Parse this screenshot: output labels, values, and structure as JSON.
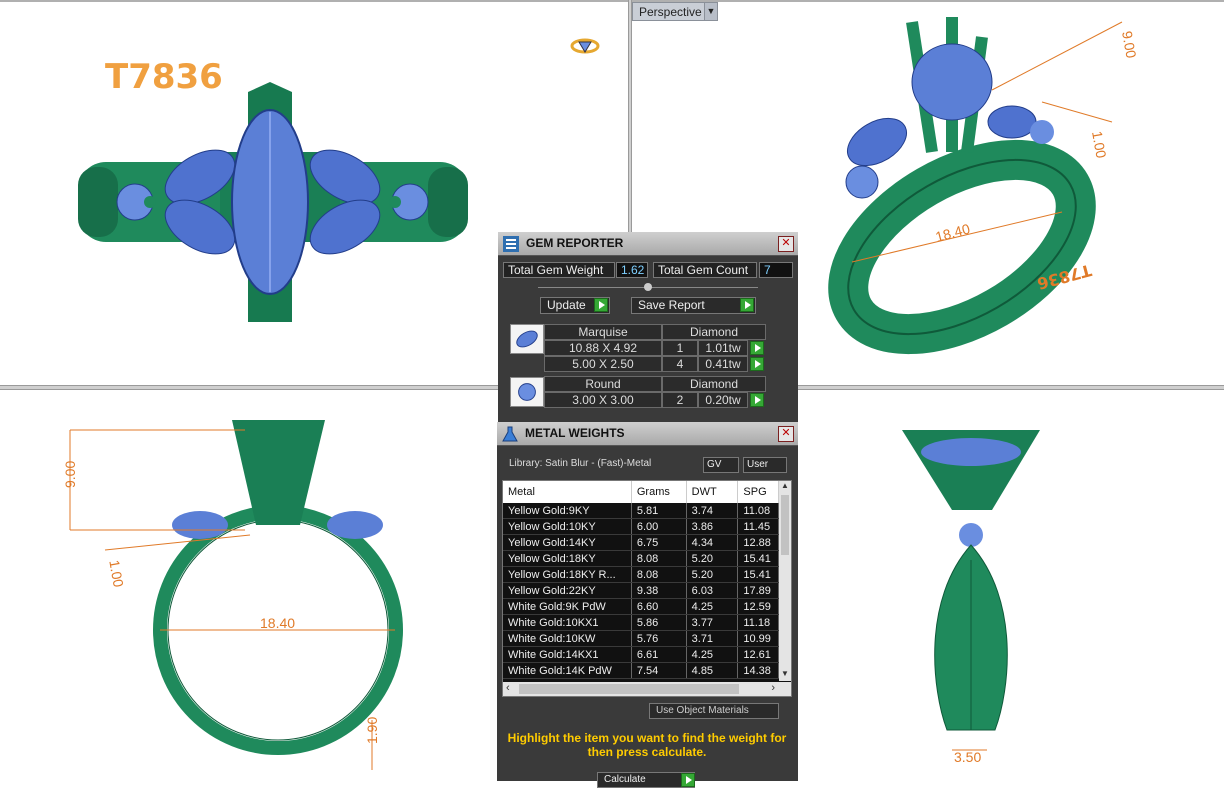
{
  "model_label": "T7836",
  "viewport_label": "Perspective",
  "dims": {
    "ring_width": "18.40",
    "height": "9.00",
    "band": "1.00",
    "shank": "1.90",
    "side_width": "3.50",
    "engraving": "T7836",
    "small_label": "1.00",
    "tiny_label": "1.90"
  },
  "gem_reporter": {
    "title": "GEM REPORTER",
    "total_weight_label": "Total Gem Weight",
    "total_weight": "1.62",
    "total_count_label": "Total Gem Count",
    "total_count": "7",
    "update_label": "Update",
    "save_label": "Save Report",
    "groups": [
      {
        "shape": "Marquise",
        "material": "Diamond",
        "rows": [
          {
            "size": "10.88 X 4.92",
            "count": "1",
            "weight": "1.01tw"
          },
          {
            "size": "5.00 X 2.50",
            "count": "4",
            "weight": "0.41tw"
          }
        ]
      },
      {
        "shape": "Round",
        "material": "Diamond",
        "rows": [
          {
            "size": "3.00 X 3.00",
            "count": "2",
            "weight": "0.20tw"
          }
        ]
      }
    ]
  },
  "metal_weights": {
    "title": "METAL WEIGHTS",
    "library": "Library: Satin Blur - (Fast)-Metal",
    "gv_label": "GV",
    "user_label": "User",
    "columns": [
      "Metal",
      "Grams",
      "DWT",
      "SPG"
    ],
    "rows": [
      [
        "Yellow Gold:9KY",
        "5.81",
        "3.74",
        "11.08"
      ],
      [
        "Yellow Gold:10KY",
        "6.00",
        "3.86",
        "11.45"
      ],
      [
        "Yellow Gold:14KY",
        "6.75",
        "4.34",
        "12.88"
      ],
      [
        "Yellow Gold:18KY",
        "8.08",
        "5.20",
        "15.41"
      ],
      [
        "Yellow Gold:18KY R...",
        "8.08",
        "5.20",
        "15.41"
      ],
      [
        "Yellow Gold:22KY",
        "9.38",
        "6.03",
        "17.89"
      ],
      [
        "White Gold:9K PdW",
        "6.60",
        "4.25",
        "12.59"
      ],
      [
        "White Gold:10KX1",
        "5.86",
        "3.77",
        "11.18"
      ],
      [
        "White Gold:10KW",
        "5.76",
        "3.71",
        "10.99"
      ],
      [
        "White Gold:14KX1",
        "6.61",
        "4.25",
        "12.61"
      ],
      [
        "White Gold:14K PdW",
        "7.54",
        "4.85",
        "14.38"
      ]
    ],
    "use_materials_label": "Use Object Materials",
    "hint": "Highlight the item you want to find the weight for then press calculate.",
    "calculate_label": "Calculate"
  },
  "colors": {
    "metal": "#1f8a5c",
    "metal_dark": "#0f5a3a",
    "gem": "#5b7fd6",
    "dimension": "#e07a28",
    "label": "#f0a040"
  }
}
